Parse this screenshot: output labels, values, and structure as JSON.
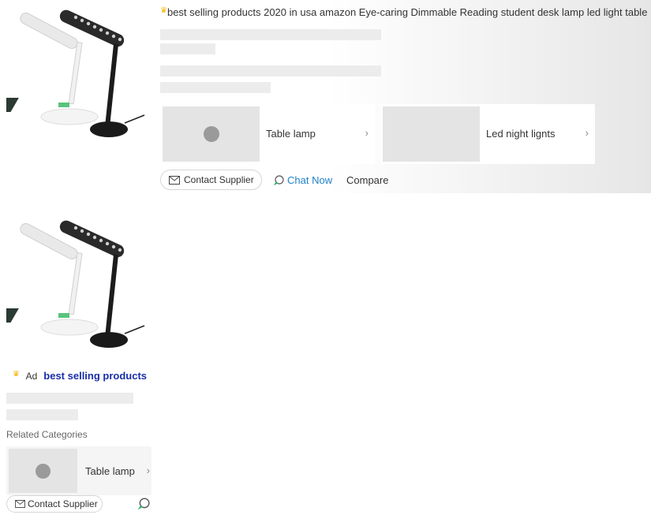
{
  "card1": {
    "title": "best selling products 2020 in usa amazon Eye-caring Dimmable Reading student desk lamp led light table",
    "categories": [
      {
        "label": "Table lamp"
      },
      {
        "label": "Led night lignts"
      }
    ],
    "contact_label": "Contact Supplier",
    "chat_label": "Chat Now",
    "compare_label": "Compare"
  },
  "card2": {
    "ad_badge": "Ad",
    "title": "best selling products",
    "related_label": "Related Categories",
    "categories": [
      {
        "label": "Table lamp"
      }
    ],
    "contact_label": "Contact Supplier"
  },
  "icons": {
    "crown": "crown-icon",
    "mail": "mail-icon",
    "chat": "chat-icon",
    "chevron": "chevron-right-icon"
  },
  "colors": {
    "chat_blue": "#1e80c8",
    "ad_title_blue": "#1a2ea8",
    "crown_gold": "#f5b400",
    "chat_green": "#2fb36b"
  }
}
